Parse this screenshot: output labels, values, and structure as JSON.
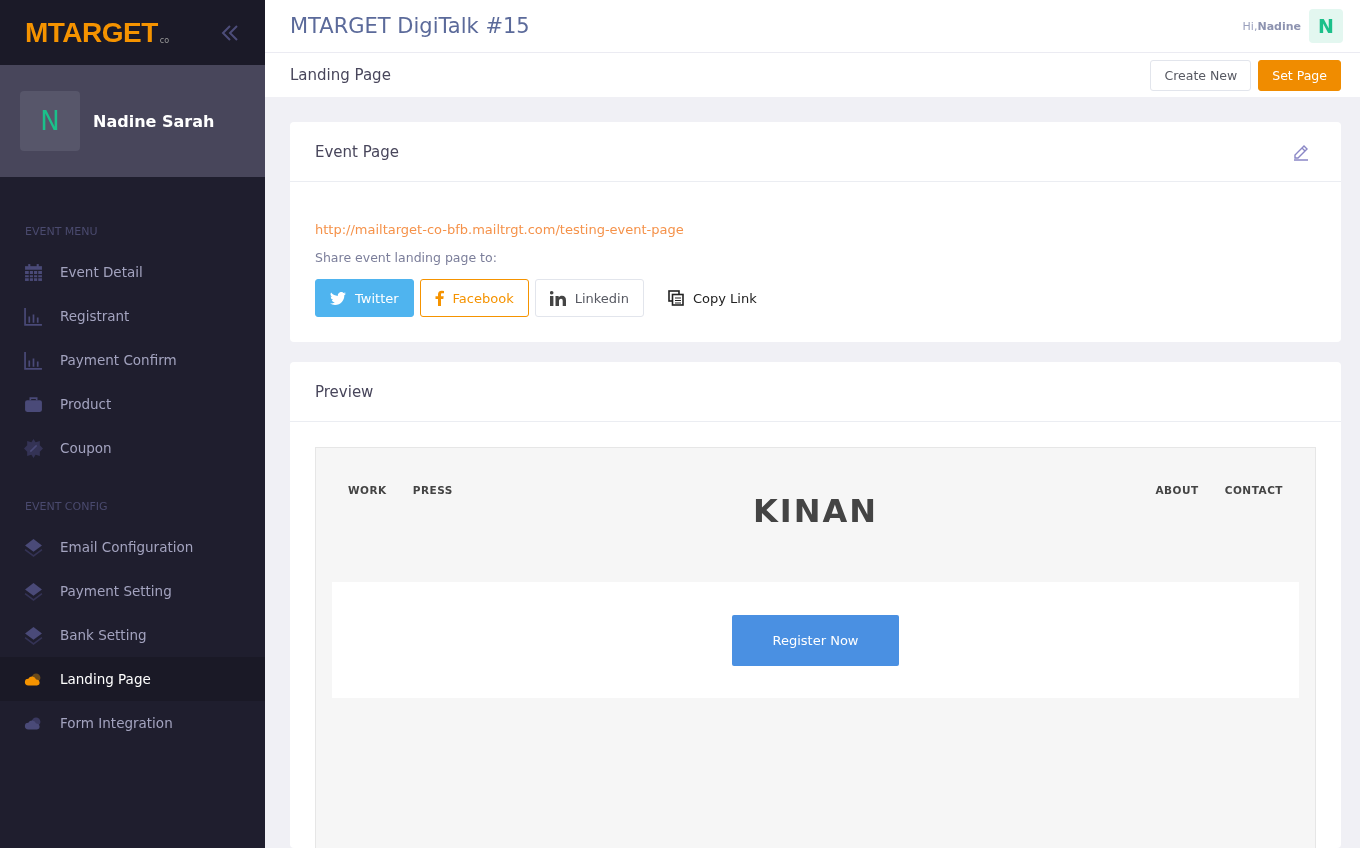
{
  "sidebar": {
    "logo": {
      "text": "MTARGET",
      "suffix": "co"
    },
    "user": {
      "initial": "N",
      "name": "Nadine Sarah"
    },
    "sections": [
      {
        "title": "EVENT MENU",
        "items": [
          {
            "label": "Event Detail",
            "kind": "calendar",
            "selected": false
          },
          {
            "label": "Registrant",
            "kind": "chart",
            "selected": false
          },
          {
            "label": "Payment Confirm",
            "kind": "chart",
            "selected": false
          },
          {
            "label": "Product",
            "kind": "bag",
            "selected": false
          },
          {
            "label": "Coupon",
            "kind": "badge",
            "selected": false
          }
        ]
      },
      {
        "title": "EVENT CONFIG",
        "items": [
          {
            "label": "Email Configuration",
            "kind": "layers",
            "selected": false
          },
          {
            "label": "Payment Setting",
            "kind": "layers",
            "selected": false
          },
          {
            "label": "Bank Setting",
            "kind": "layers",
            "selected": false
          },
          {
            "label": "Landing Page",
            "kind": "cloud",
            "selected": true
          },
          {
            "label": "Form Integration",
            "kind": "cloud",
            "selected": false
          }
        ]
      }
    ]
  },
  "header": {
    "title": "MTARGET DigiTalk #15",
    "greeting": "Hi,",
    "user_name": "Nadine",
    "avatar_initial": "N"
  },
  "subheader": {
    "title": "Landing Page",
    "buttons": [
      {
        "label": "Create New",
        "kind": "outline"
      },
      {
        "label": "Set Page",
        "kind": "primary"
      }
    ]
  },
  "event_card": {
    "title": "Event Page",
    "url": "http://mailtarget-co-bfb.mailtrgt.com/testing-event-page",
    "share_label": "Share event landing page to:",
    "share_buttons": [
      {
        "label": "Twitter",
        "kind": "twitter"
      },
      {
        "label": "Facebook",
        "kind": "facebook"
      },
      {
        "label": "Linkedin",
        "kind": "linkedin"
      },
      {
        "label": "Copy Link",
        "kind": "copy"
      }
    ]
  },
  "preview": {
    "title": "Preview",
    "site": {
      "nav_left": [
        "WORK",
        "PRESS"
      ],
      "logo": "KINAN",
      "nav_right": [
        "ABOUT",
        "CONTACT"
      ],
      "button": "Register Now"
    }
  }
}
